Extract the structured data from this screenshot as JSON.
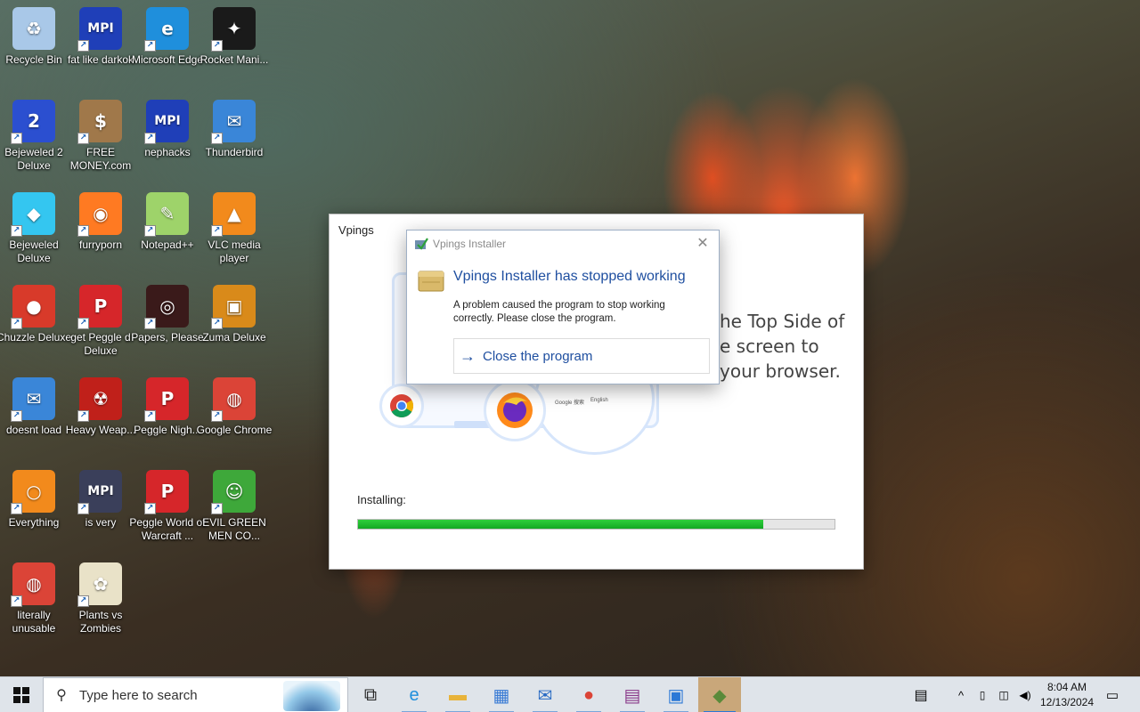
{
  "desktop": {
    "icons": [
      {
        "label": "Recycle Bin",
        "icon": "recycle-bin-icon",
        "color": "#a9c8e8"
      },
      {
        "label": "fat like darkok",
        "icon": "mpi-icon",
        "color": "#1f3fb8"
      },
      {
        "label": "Microsoft Edge",
        "icon": "edge-icon",
        "color": "#1f8fdc"
      },
      {
        "label": "Rocket Mani...",
        "icon": "rocket-mania-icon",
        "color": "#1a1a1a"
      },
      {
        "label": "Bejeweled 2 Deluxe",
        "icon": "bejeweled2-icon",
        "color": "#2b4fd0"
      },
      {
        "label": "FREE MONEY.com",
        "icon": "money-bag-icon",
        "color": "#a0784a"
      },
      {
        "label": "nephacks",
        "icon": "mpi-icon",
        "color": "#1f3fb8"
      },
      {
        "label": "Thunderbird",
        "icon": "thunderbird-icon",
        "color": "#3a86d8"
      },
      {
        "label": "Bejeweled Deluxe",
        "icon": "diamond-icon",
        "color": "#34c6f0"
      },
      {
        "label": "furryporn",
        "icon": "firefox-icon",
        "color": "#ff7a22"
      },
      {
        "label": "Notepad++",
        "icon": "notepadpp-icon",
        "color": "#9ed36a"
      },
      {
        "label": "VLC media player",
        "icon": "vlc-icon",
        "color": "#f28a1c"
      },
      {
        "label": "Chuzzle Deluxe",
        "icon": "chuzzle-icon",
        "color": "#d83a2a"
      },
      {
        "label": "get Peggle d Deluxe",
        "icon": "peggle-icon",
        "color": "#d6262a"
      },
      {
        "label": "Papers, Please",
        "icon": "papers-please-icon",
        "color": "#3a1a1a"
      },
      {
        "label": "Zuma Deluxe",
        "icon": "zuma-icon",
        "color": "#d98a1a"
      },
      {
        "label": "doesnt load",
        "icon": "thunderbird-icon",
        "color": "#3a86d8"
      },
      {
        "label": "Heavy Weap...",
        "icon": "radiation-icon",
        "color": "#c0201a"
      },
      {
        "label": "Peggle Nigh...",
        "icon": "peggle-icon",
        "color": "#d6262a"
      },
      {
        "label": "Google Chrome",
        "icon": "chrome-icon",
        "color": "#db4437"
      },
      {
        "label": "Everything",
        "icon": "magnifier-icon",
        "color": "#f28a1c"
      },
      {
        "label": "is very",
        "icon": "mpi-shield-icon",
        "color": "#3a3f5a"
      },
      {
        "label": "Peggle World of Warcraft ...",
        "icon": "peggle-icon",
        "color": "#d6262a"
      },
      {
        "label": "EVIL GREEN MEN CO...",
        "icon": "users-icon",
        "color": "#3ea83a"
      },
      {
        "label": "literally unusable",
        "icon": "chrome-icon",
        "color": "#db4437"
      },
      {
        "label": "Plants vs Zombies",
        "icon": "plants-icon",
        "color": "#e9e2c8"
      }
    ]
  },
  "installer": {
    "title": "Vpings",
    "promo": [
      "he Top Side of",
      "e screen to",
      "your browser."
    ],
    "mini_text": [
      "Google 搜索",
      "English"
    ],
    "progress_label": "Installing:",
    "progress_fraction": 0.85
  },
  "error_dialog": {
    "title": "Vpings Installer",
    "heading": "Vpings Installer has stopped working",
    "message": "A problem caused the program to stop working correctly. Please close the program.",
    "action_label": "Close the program"
  },
  "taskbar": {
    "search_placeholder": "Type here to search",
    "apps": [
      {
        "name": "task-view-icon",
        "glyph": "⧉"
      },
      {
        "name": "edge-icon",
        "glyph": "e"
      },
      {
        "name": "file-explorer-icon",
        "glyph": "▬"
      },
      {
        "name": "store-icon",
        "glyph": "▦"
      },
      {
        "name": "mail-icon",
        "glyph": "✉"
      },
      {
        "name": "chrome-icon",
        "glyph": "●"
      },
      {
        "name": "winrar-icon",
        "glyph": "▤"
      },
      {
        "name": "window-app-icon",
        "glyph": "▣"
      },
      {
        "name": "installer-icon",
        "glyph": "◆"
      }
    ],
    "time": "8:04 AM",
    "date": "12/13/2024",
    "colors": {
      "accent": "#2b78d6",
      "progress": "#13a823",
      "link": "#1f4fa0"
    }
  }
}
